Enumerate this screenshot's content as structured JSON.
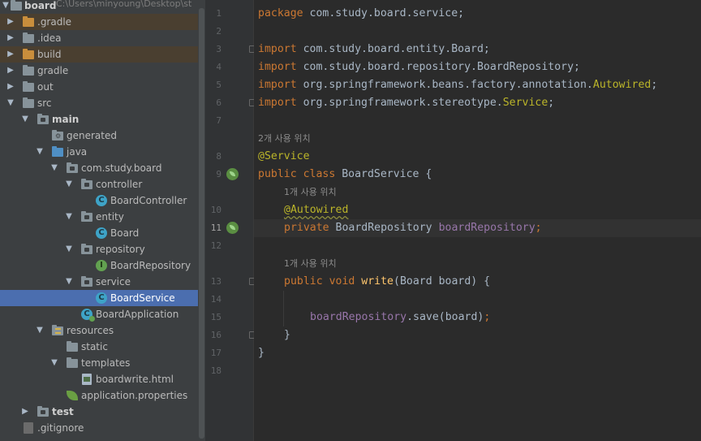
{
  "tree": {
    "root": {
      "name": "board",
      "path": "C:\\Users\\minyoung\\Desktop\\st"
    },
    "items": [
      {
        "label": ".gradle",
        "arrow": "▶"
      },
      {
        "label": ".idea",
        "arrow": "▶"
      },
      {
        "label": "build",
        "arrow": "▶"
      },
      {
        "label": "gradle",
        "arrow": "▶"
      },
      {
        "label": "out",
        "arrow": "▶"
      },
      {
        "label": "src",
        "arrow": "▼"
      },
      {
        "label": "main",
        "arrow": "▼"
      },
      {
        "label": "generated",
        "arrow": ""
      },
      {
        "label": "java",
        "arrow": "▼"
      },
      {
        "label": "com.study.board",
        "arrow": "▼"
      },
      {
        "label": "controller",
        "arrow": "▼"
      },
      {
        "label": "BoardController",
        "arrow": ""
      },
      {
        "label": "entity",
        "arrow": "▼"
      },
      {
        "label": "Board",
        "arrow": ""
      },
      {
        "label": "repository",
        "arrow": "▼"
      },
      {
        "label": "BoardRepository",
        "arrow": ""
      },
      {
        "label": "service",
        "arrow": "▼"
      },
      {
        "label": "BoardService",
        "arrow": ""
      },
      {
        "label": "BoardApplication",
        "arrow": ""
      },
      {
        "label": "resources",
        "arrow": "▼"
      },
      {
        "label": "static",
        "arrow": ""
      },
      {
        "label": "templates",
        "arrow": "▼"
      },
      {
        "label": "boardwrite.html",
        "arrow": ""
      },
      {
        "label": "application.properties",
        "arrow": ""
      },
      {
        "label": "test",
        "arrow": "▶"
      },
      {
        "label": ".gitignore",
        "arrow": ""
      }
    ],
    "icon_letters": {
      "class": "C",
      "interface": "I",
      "generated_badge": "⚙"
    }
  },
  "gutter": {
    "line_numbers": [
      "1",
      "2",
      "3",
      "4",
      "5",
      "6",
      "7",
      "8",
      "9",
      "10",
      "11",
      "12",
      "13",
      "14",
      "15",
      "16",
      "17",
      "18"
    ]
  },
  "editor": {
    "hints": {
      "class_usages": "2개 사용 위치",
      "field_usages": "1개 사용 위치",
      "method_usages": "1개 사용 위치"
    },
    "code": {
      "l1_kw": "package",
      "l1_rest": " com.study.board.service;",
      "l3_kw": "import",
      "l3_rest": " com.study.board.entity.Board;",
      "l4_kw": "import",
      "l4_rest": " com.study.board.repository.BoardRepository;",
      "l5_kw": "import",
      "l5_rest": " org.springframework.beans.factory.annotation.",
      "l5_ann": "Autowired",
      "l5_end": ";",
      "l6_kw": "import",
      "l6_rest": " org.springframework.stereotype.",
      "l6_ann": "Service",
      "l6_end": ";",
      "l8_ann": "@Service",
      "l9_kw": "public class",
      "l9_rest": " BoardService {",
      "l10_ann": "@Autowired",
      "l11_kw": "private",
      "l11_type": " BoardRepository ",
      "l11_field": "boardRepository",
      "l11_end": ";",
      "l13_kw": "public void",
      "l13_sp": " ",
      "l13_fn": "write",
      "l13_rest": "(Board board) {",
      "l15_field": "boardRepository",
      "l15_rest": ".save(board)",
      "l15_end": ";",
      "l16": "}",
      "l17": "}"
    }
  },
  "colors": {
    "keyword": "#cc7832",
    "annotation": "#bbb529",
    "method": "#ffc66d",
    "field": "#9876aa",
    "selection": "#4b6eaf"
  }
}
